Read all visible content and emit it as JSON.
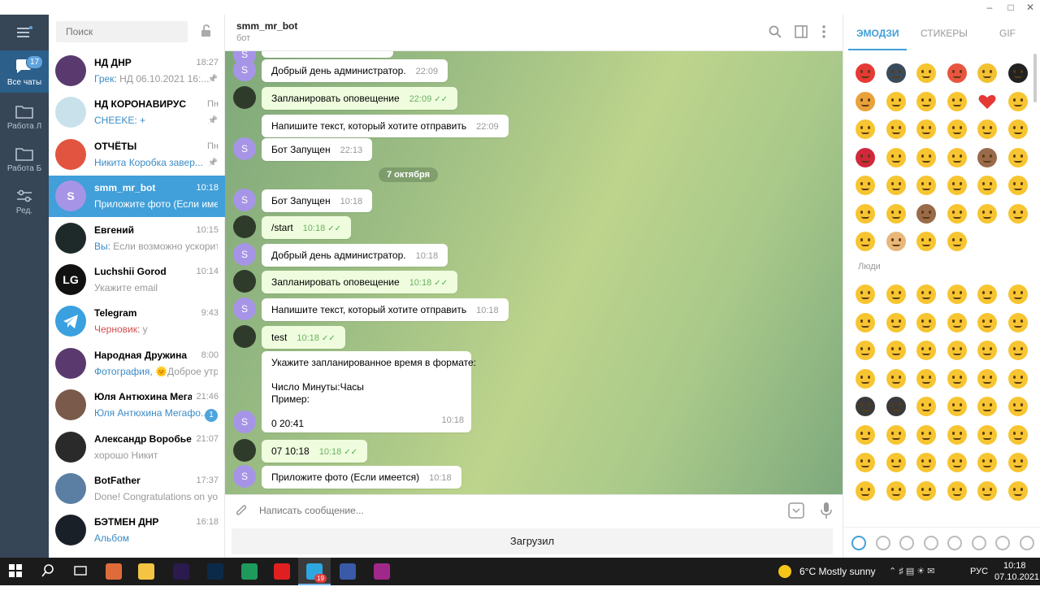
{
  "rail": {
    "items": [
      {
        "label": "Все чаты",
        "badge": "17"
      },
      {
        "label": "Работа Л"
      },
      {
        "label": "Работа Б"
      },
      {
        "label": "Ред."
      }
    ]
  },
  "search": {
    "placeholder": "Поиск"
  },
  "chats": [
    {
      "name": "НД ДНР",
      "time": "18:27",
      "preview_sender": "Грек:",
      "preview": " НД  06.10.2021 16:...",
      "pinned": true,
      "avatar_color": "#5a3a6e"
    },
    {
      "name": "НД КОРОНАВИРУС",
      "time": "Пн",
      "preview_sender": "CHEEKE:",
      "preview": " +",
      "pinned": true,
      "avatar_color": "#c9e1ea"
    },
    {
      "name": "ОТЧЁТЫ",
      "time": "Пн",
      "preview": "Никита Коробка завер...",
      "pinned": true,
      "avatar_color": "#e2543f"
    },
    {
      "name": "smm_mr_bot",
      "time": "10:18",
      "preview": "Приложите фото (Если име...",
      "avatar_letter": "S",
      "avatar_color": "#a695e7"
    },
    {
      "name": "Евгений",
      "time": "10:15",
      "preview_sender": "Вы:",
      "preview": " Если возможно ускорит...",
      "avatar_color": "#1e2a2a"
    },
    {
      "name": "Luchshii Gorod",
      "time": "10:14",
      "preview": "Укажите email",
      "avatar_letter": "LG",
      "avatar_color": "#111111"
    },
    {
      "name": "Telegram",
      "time": "9:43",
      "preview_sender": "Черновик:",
      "preview": " у",
      "avatar_color": "#3aa0e0"
    },
    {
      "name": "Народная Дружина",
      "time": "8:00",
      "preview_sender": "Фотография,",
      "preview": " 🌞Доброе утр...",
      "avatar_color": "#5a3a6e"
    },
    {
      "name": "Юля Антюхина Мега...",
      "time": "21:46",
      "preview": "Юля Антюхина Мегафо...",
      "unread": "1",
      "avatar_color": "#7a5a4a"
    },
    {
      "name": "Александр Воробьев",
      "time": "21:07",
      "preview": "хорошо Никит",
      "avatar_color": "#2a2a2a"
    },
    {
      "name": "BotFather",
      "time": "17:37",
      "preview": "Done! Congratulations on yo...",
      "avatar_color": "#5b7fa3"
    },
    {
      "name": "БЭТМЕН ДНР",
      "time": "16:18",
      "preview": "Альбом",
      "avatar_color": "#1a2028"
    }
  ],
  "header": {
    "title": "smm_mr_bot",
    "status": "бот"
  },
  "messages": [
    {
      "text": "Добрый день администратор.",
      "time": "22:09",
      "dir": "in"
    },
    {
      "text": "Запланировать оповещение",
      "time": "22:09",
      "dir": "out"
    },
    {
      "text": "Напишите текст, который хотите отправить",
      "time": "22:09",
      "dir": "in"
    },
    {
      "text": "Бот Запущен",
      "time": "22:13",
      "dir": "in"
    },
    {
      "text": "Бот Запущен",
      "time": "10:18",
      "dir": "in"
    },
    {
      "text": "/start",
      "time": "10:18",
      "dir": "out"
    },
    {
      "text": "Добрый день администратор.",
      "time": "10:18",
      "dir": "in"
    },
    {
      "text": "Запланировать оповещение",
      "time": "10:18",
      "dir": "out"
    },
    {
      "text": "Напишите текст, который хотите отправить",
      "time": "10:18",
      "dir": "in"
    },
    {
      "text": "test",
      "time": "10:18",
      "dir": "out"
    },
    {
      "lines": [
        "Укажите запланированное время в формате:",
        "",
        "Число Минуты:Часы",
        "Пример:",
        "",
        "0 20:41"
      ],
      "time": "10:18",
      "dir": "in"
    },
    {
      "text": "07 10:18",
      "time": "10:18",
      "dir": "out"
    },
    {
      "text": "Приложите фото (Если имеется)",
      "time": "10:18",
      "dir": "in"
    }
  ],
  "date_divider": "7 октября",
  "avatar_letter": "S",
  "composer": {
    "placeholder": "Написать сообщение..."
  },
  "keyboard": {
    "button_label": "Загрузил"
  },
  "emoji_panel": {
    "tabs": [
      "ЭМОДЗИ",
      "СТИКЕРЫ",
      "GIF"
    ],
    "section_people": "Люди",
    "recent": [
      "pin-emoji",
      "speaking-head-emoji",
      "money-mouth-emoji",
      "pouting-emoji",
      "thumbs-up-emoji",
      "graduation-cap-emoji",
      "writing-hand-emoji",
      "fearful-emoji",
      "joy-emoji",
      "kissing-heart-emoji",
      "red-heart-emoji",
      "heart-eyes-emoji",
      "blush-emoji",
      "grinning-emoji",
      "relaxed-emoji",
      "expressionless-emoji",
      "beaming-emoji",
      "sob-emoji",
      "kiss-mark-emoji",
      "unamused-emoji",
      "flushed-emoji",
      "winking-tongue-emoji",
      "see-no-evil-emoji",
      "wink-emoji",
      "smiley-emoji",
      "disappointed-relieved-emoji",
      "squinting-tongue-emoji",
      "scream-emoji",
      "smirk-emoji",
      "disappointed-emoji",
      "sweat-smile-emoji",
      "kissing-closed-eyes-emoji",
      "monkey-face-emoji",
      "relieved-emoji",
      "grin-emoji",
      "yum-emoji",
      "laughing-emoji",
      "ok-hand-emoji",
      "neutral-emoji",
      "confused-emoji"
    ],
    "recent_colors": [
      "#e53935",
      "#3a4b5c",
      "#f7c531",
      "#e8553f",
      "#f2c132",
      "#222222",
      "#e9a23b",
      "#f7c531",
      "#f7c531",
      "#f7c531",
      "#e53935",
      "#f7c531",
      "#f7c531",
      "#f7c531",
      "#f7c531",
      "#f7c531",
      "#f7c531",
      "#f7c531",
      "#d1283c",
      "#f7c531",
      "#f7c531",
      "#f7c531",
      "#9a6b4a",
      "#f7c531",
      "#f7c531",
      "#f7c531",
      "#f7c531",
      "#f7c531",
      "#f7c531",
      "#f7c531",
      "#f7c531",
      "#f7c531",
      "#9a6b4a",
      "#f7c531",
      "#f7c531",
      "#f7c531",
      "#f7c531",
      "#e9b77a",
      "#f7c531",
      "#f7c531"
    ],
    "people_count": 54,
    "categories": [
      "recent-icon",
      "smile-icon",
      "animals-icon",
      "food-icon",
      "activity-icon",
      "travel-icon",
      "objects-icon",
      "symbols-icon"
    ]
  },
  "taskbar": {
    "weather": "6°C  Mostly sunny",
    "lang": "РУС",
    "time": "10:18",
    "date": "07.10.2021",
    "telegram_badge": "19",
    "apps": [
      "start-icon",
      "search-icon",
      "task-view-icon",
      "paint-icon",
      "file-explorer-icon",
      "after-effects-icon",
      "photoshop-icon",
      "pycharm-icon",
      "yandex-icon",
      "telegram-icon",
      "app-icon",
      "winrar-icon"
    ]
  },
  "colors": {
    "accent": "#419fd9",
    "rail": "#364656",
    "out_bubble": "#effdde"
  }
}
